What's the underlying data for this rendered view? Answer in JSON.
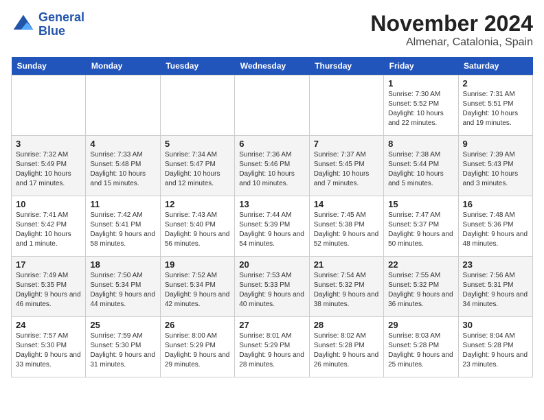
{
  "header": {
    "logo_line1": "General",
    "logo_line2": "Blue",
    "month": "November 2024",
    "location": "Almenar, Catalonia, Spain"
  },
  "weekdays": [
    "Sunday",
    "Monday",
    "Tuesday",
    "Wednesday",
    "Thursday",
    "Friday",
    "Saturday"
  ],
  "weeks": [
    [
      {
        "day": "",
        "info": ""
      },
      {
        "day": "",
        "info": ""
      },
      {
        "day": "",
        "info": ""
      },
      {
        "day": "",
        "info": ""
      },
      {
        "day": "",
        "info": ""
      },
      {
        "day": "1",
        "info": "Sunrise: 7:30 AM\nSunset: 5:52 PM\nDaylight: 10 hours and 22 minutes."
      },
      {
        "day": "2",
        "info": "Sunrise: 7:31 AM\nSunset: 5:51 PM\nDaylight: 10 hours and 19 minutes."
      }
    ],
    [
      {
        "day": "3",
        "info": "Sunrise: 7:32 AM\nSunset: 5:49 PM\nDaylight: 10 hours and 17 minutes."
      },
      {
        "day": "4",
        "info": "Sunrise: 7:33 AM\nSunset: 5:48 PM\nDaylight: 10 hours and 15 minutes."
      },
      {
        "day": "5",
        "info": "Sunrise: 7:34 AM\nSunset: 5:47 PM\nDaylight: 10 hours and 12 minutes."
      },
      {
        "day": "6",
        "info": "Sunrise: 7:36 AM\nSunset: 5:46 PM\nDaylight: 10 hours and 10 minutes."
      },
      {
        "day": "7",
        "info": "Sunrise: 7:37 AM\nSunset: 5:45 PM\nDaylight: 10 hours and 7 minutes."
      },
      {
        "day": "8",
        "info": "Sunrise: 7:38 AM\nSunset: 5:44 PM\nDaylight: 10 hours and 5 minutes."
      },
      {
        "day": "9",
        "info": "Sunrise: 7:39 AM\nSunset: 5:43 PM\nDaylight: 10 hours and 3 minutes."
      }
    ],
    [
      {
        "day": "10",
        "info": "Sunrise: 7:41 AM\nSunset: 5:42 PM\nDaylight: 10 hours and 1 minute."
      },
      {
        "day": "11",
        "info": "Sunrise: 7:42 AM\nSunset: 5:41 PM\nDaylight: 9 hours and 58 minutes."
      },
      {
        "day": "12",
        "info": "Sunrise: 7:43 AM\nSunset: 5:40 PM\nDaylight: 9 hours and 56 minutes."
      },
      {
        "day": "13",
        "info": "Sunrise: 7:44 AM\nSunset: 5:39 PM\nDaylight: 9 hours and 54 minutes."
      },
      {
        "day": "14",
        "info": "Sunrise: 7:45 AM\nSunset: 5:38 PM\nDaylight: 9 hours and 52 minutes."
      },
      {
        "day": "15",
        "info": "Sunrise: 7:47 AM\nSunset: 5:37 PM\nDaylight: 9 hours and 50 minutes."
      },
      {
        "day": "16",
        "info": "Sunrise: 7:48 AM\nSunset: 5:36 PM\nDaylight: 9 hours and 48 minutes."
      }
    ],
    [
      {
        "day": "17",
        "info": "Sunrise: 7:49 AM\nSunset: 5:35 PM\nDaylight: 9 hours and 46 minutes."
      },
      {
        "day": "18",
        "info": "Sunrise: 7:50 AM\nSunset: 5:34 PM\nDaylight: 9 hours and 44 minutes."
      },
      {
        "day": "19",
        "info": "Sunrise: 7:52 AM\nSunset: 5:34 PM\nDaylight: 9 hours and 42 minutes."
      },
      {
        "day": "20",
        "info": "Sunrise: 7:53 AM\nSunset: 5:33 PM\nDaylight: 9 hours and 40 minutes."
      },
      {
        "day": "21",
        "info": "Sunrise: 7:54 AM\nSunset: 5:32 PM\nDaylight: 9 hours and 38 minutes."
      },
      {
        "day": "22",
        "info": "Sunrise: 7:55 AM\nSunset: 5:32 PM\nDaylight: 9 hours and 36 minutes."
      },
      {
        "day": "23",
        "info": "Sunrise: 7:56 AM\nSunset: 5:31 PM\nDaylight: 9 hours and 34 minutes."
      }
    ],
    [
      {
        "day": "24",
        "info": "Sunrise: 7:57 AM\nSunset: 5:30 PM\nDaylight: 9 hours and 33 minutes."
      },
      {
        "day": "25",
        "info": "Sunrise: 7:59 AM\nSunset: 5:30 PM\nDaylight: 9 hours and 31 minutes."
      },
      {
        "day": "26",
        "info": "Sunrise: 8:00 AM\nSunset: 5:29 PM\nDaylight: 9 hours and 29 minutes."
      },
      {
        "day": "27",
        "info": "Sunrise: 8:01 AM\nSunset: 5:29 PM\nDaylight: 9 hours and 28 minutes."
      },
      {
        "day": "28",
        "info": "Sunrise: 8:02 AM\nSunset: 5:28 PM\nDaylight: 9 hours and 26 minutes."
      },
      {
        "day": "29",
        "info": "Sunrise: 8:03 AM\nSunset: 5:28 PM\nDaylight: 9 hours and 25 minutes."
      },
      {
        "day": "30",
        "info": "Sunrise: 8:04 AM\nSunset: 5:28 PM\nDaylight: 9 hours and 23 minutes."
      }
    ]
  ]
}
